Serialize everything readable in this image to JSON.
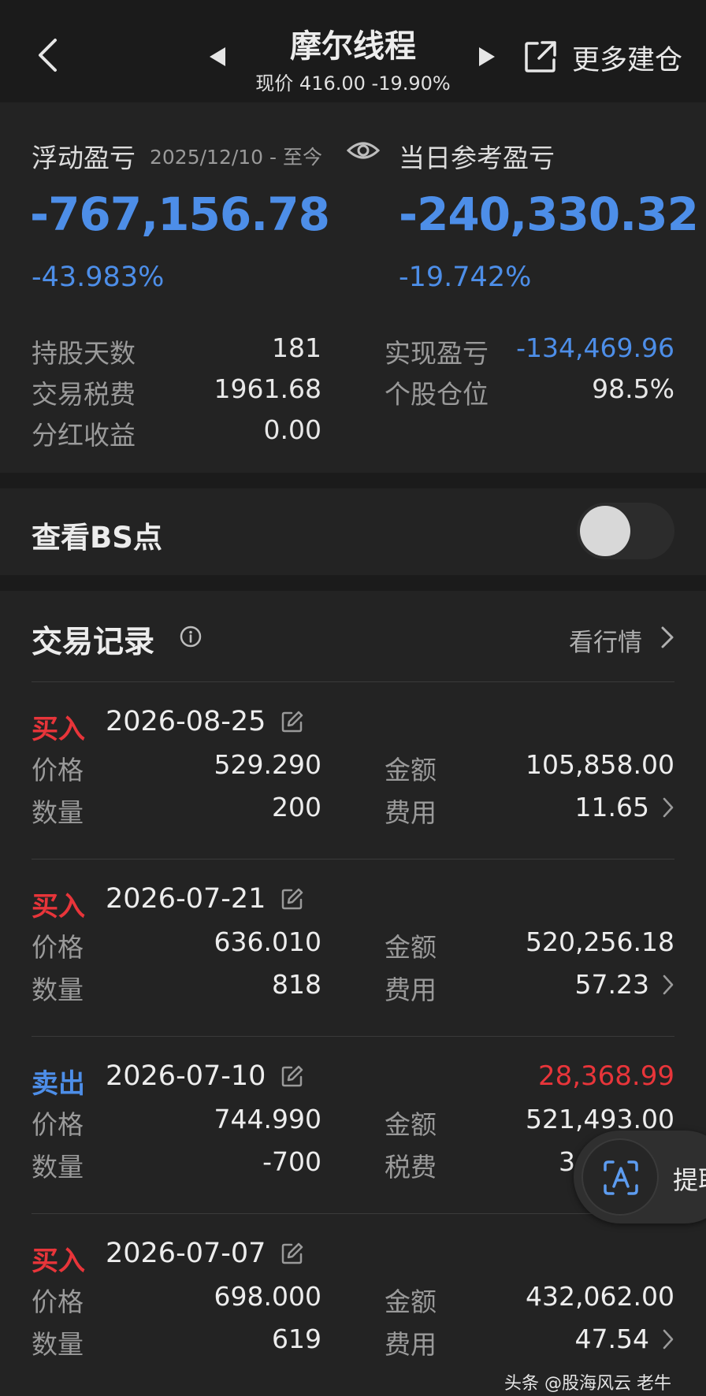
{
  "header": {
    "title": "摩尔线程",
    "subtitle": "现价 416.00 -19.90%",
    "more_label": "更多建仓"
  },
  "summary": {
    "floating_label": "浮动盈亏",
    "date_range": "2025/12/10 - 至今",
    "floating_value": "-767,156.78",
    "floating_pct": "-43.983%",
    "daily_label": "当日参考盈亏",
    "daily_value": "-240,330.32",
    "daily_pct": "-19.742%",
    "stats_left": [
      {
        "k": "持股天数",
        "v": "181"
      },
      {
        "k": "交易税费",
        "v": "1961.68"
      },
      {
        "k": "分红收益",
        "v": "0.00"
      }
    ],
    "stats_right": [
      {
        "k": "实现盈亏",
        "v": "-134,469.96"
      },
      {
        "k": "个股仓位",
        "v": "98.5%"
      }
    ]
  },
  "bs": {
    "label": "查看BS点",
    "toggle_on": false
  },
  "records": {
    "title": "交易记录",
    "market_link": "看行情",
    "items": [
      {
        "type": "买入",
        "date": "2026-08-25",
        "profit": "",
        "k1": "价格",
        "v1": "529.290",
        "k2": "金额",
        "v2": "105,858.00",
        "k3": "数量",
        "v3": "200",
        "k4": "费用",
        "v4": "11.65"
      },
      {
        "type": "买入",
        "date": "2026-07-21",
        "profit": "",
        "k1": "价格",
        "v1": "636.010",
        "k2": "金额",
        "v2": "520,256.18",
        "k3": "数量",
        "v3": "818",
        "k4": "费用",
        "v4": "57.23"
      },
      {
        "type": "卖出",
        "date": "2026-07-10",
        "profit": "28,368.99",
        "k1": "价格",
        "v1": "744.990",
        "k2": "金额",
        "v2": "521,493.00",
        "k3": "数量",
        "v3": "-700",
        "k4": "税费",
        "v4": "3"
      },
      {
        "type": "买入",
        "date": "2026-07-07",
        "profit": "",
        "k1": "价格",
        "v1": "698.000",
        "k2": "金额",
        "v2": "432,062.00",
        "k3": "数量",
        "v3": "619",
        "k4": "费用",
        "v4": "47.54"
      }
    ]
  },
  "float_button": {
    "label": "提取"
  },
  "watermark": "头条 @股海风云  老牛",
  "colors": {
    "loss_blue": "#4d8ee8",
    "buy_red": "#e8353a",
    "bg": "#1b1b1b",
    "card": "#232323"
  }
}
